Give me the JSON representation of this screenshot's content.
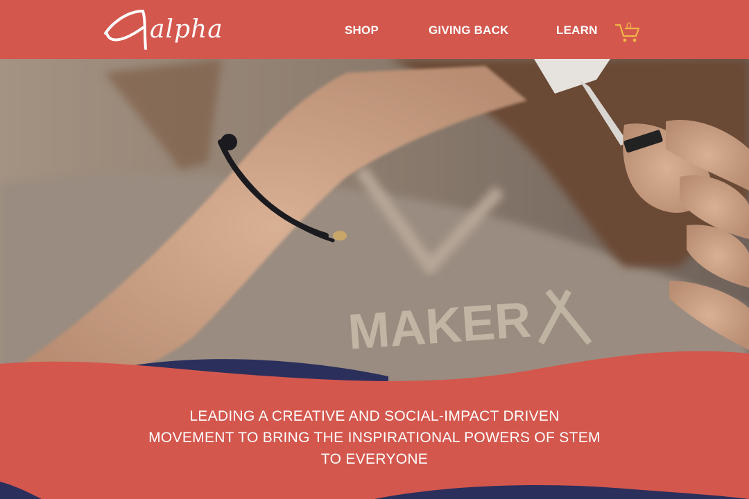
{
  "brand": {
    "logo_text": "alpha"
  },
  "nav": {
    "shop": "SHOP",
    "giving_back": "GIVING BACK",
    "learn": "LEARN"
  },
  "cart": {
    "count": "0",
    "icon": "cart-icon"
  },
  "hero": {
    "shirt_text": "MAKER"
  },
  "tagline": {
    "line1": "LEADING A CREATIVE AND SOCIAL-IMPACT DRIVEN",
    "line2": "MOVEMENT TO BRING THE INSPIRATIONAL POWERS OF STEM",
    "line3": "TO EVERYONE"
  },
  "colors": {
    "brand_red": "#d4574d",
    "navy": "#2b2f5c",
    "cart_gold": "#f1b548"
  }
}
